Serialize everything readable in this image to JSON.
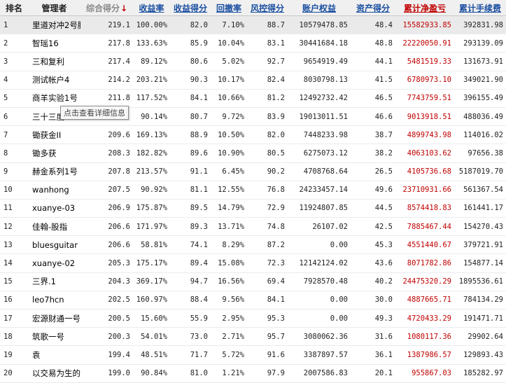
{
  "columns": {
    "rank": "排名",
    "manager": "管理者",
    "composite": "综合得分",
    "return_rate": "收益率",
    "return_score": "收益得分",
    "drawdown": "回撤率",
    "risk_score": "风控得分",
    "equity": "账户权益",
    "asset_score": "资产得分",
    "cum_pnl": "累计净盈亏",
    "cum_fee": "累计手续费"
  },
  "sort_arrow": "↓",
  "tooltip": "点击查看详细信息",
  "colors": {
    "header_bg": "#f0f0f0",
    "link_blue": "#1a4fa0",
    "red": "#c00000",
    "selected_row": "#eaeaea"
  },
  "rows": [
    {
      "rank": "1",
      "manager": "里道对冲2号腾",
      "composite": "219.1",
      "return_rate": "100.00%",
      "return_score": "82.0",
      "drawdown": "7.10%",
      "risk_score": "88.7",
      "equity": "10579478.85",
      "asset_score": "48.4",
      "cum_pnl": "15582933.85",
      "cum_fee": "392831.98"
    },
    {
      "rank": "2",
      "manager": "智瑶16",
      "composite": "217.8",
      "return_rate": "133.63%",
      "return_score": "85.9",
      "drawdown": "10.04%",
      "risk_score": "83.1",
      "equity": "30441684.18",
      "asset_score": "48.8",
      "cum_pnl": "22220050.91",
      "cum_fee": "293139.09"
    },
    {
      "rank": "3",
      "manager": "三和复利",
      "composite": "217.4",
      "return_rate": "89.12%",
      "return_score": "80.6",
      "drawdown": "5.02%",
      "risk_score": "92.7",
      "equity": "9654919.49",
      "asset_score": "44.1",
      "cum_pnl": "5481519.33",
      "cum_fee": "131673.91"
    },
    {
      "rank": "4",
      "manager": "测试帐户4",
      "composite": "214.2",
      "return_rate": "203.21%",
      "return_score": "90.3",
      "drawdown": "10.17%",
      "risk_score": "82.4",
      "equity": "8030798.13",
      "asset_score": "41.5",
      "cum_pnl": "6780973.10",
      "cum_fee": "349021.90"
    },
    {
      "rank": "5",
      "manager": "商羊实验1号",
      "composite": "211.8",
      "return_rate": "117.52%",
      "return_score": "84.1",
      "drawdown": "10.66%",
      "risk_score": "81.2",
      "equity": "12492732.42",
      "asset_score": "46.5",
      "cum_pnl": "7743759.51",
      "cum_fee": "396155.49"
    },
    {
      "rank": "6",
      "manager": "三十三度",
      "composite": "",
      "return_rate": "90.14%",
      "return_score": "80.7",
      "drawdown": "9.72%",
      "risk_score": "83.9",
      "equity": "19013011.51",
      "asset_score": "46.6",
      "cum_pnl": "9013918.51",
      "cum_fee": "488036.49"
    },
    {
      "rank": "7",
      "manager": "锄获金II",
      "composite": "209.6",
      "return_rate": "169.13%",
      "return_score": "88.9",
      "drawdown": "10.50%",
      "risk_score": "82.0",
      "equity": "7448233.98",
      "asset_score": "38.7",
      "cum_pnl": "4899743.98",
      "cum_fee": "114016.02"
    },
    {
      "rank": "8",
      "manager": "锄多获",
      "composite": "208.3",
      "return_rate": "182.82%",
      "return_score": "89.6",
      "drawdown": "10.90%",
      "risk_score": "80.5",
      "equity": "6275073.12",
      "asset_score": "38.2",
      "cum_pnl": "4063103.62",
      "cum_fee": "97656.38"
    },
    {
      "rank": "9",
      "manager": "赫金系列1号",
      "composite": "207.8",
      "return_rate": "213.57%",
      "return_score": "91.1",
      "drawdown": "6.45%",
      "risk_score": "90.2",
      "equity": "4708768.64",
      "asset_score": "26.5",
      "cum_pnl": "4105736.68",
      "cum_fee": "5187019.70"
    },
    {
      "rank": "10",
      "manager": "wanhong",
      "composite": "207.5",
      "return_rate": "90.92%",
      "return_score": "81.1",
      "drawdown": "12.55%",
      "risk_score": "76.8",
      "equity": "24233457.14",
      "asset_score": "49.6",
      "cum_pnl": "23710931.66",
      "cum_fee": "561367.54"
    },
    {
      "rank": "11",
      "manager": "xuanye-03",
      "composite": "206.9",
      "return_rate": "175.87%",
      "return_score": "89.5",
      "drawdown": "14.79%",
      "risk_score": "72.9",
      "equity": "11924807.85",
      "asset_score": "44.5",
      "cum_pnl": "8574418.83",
      "cum_fee": "161441.17"
    },
    {
      "rank": "12",
      "manager": "佳翰-股指",
      "composite": "206.6",
      "return_rate": "171.97%",
      "return_score": "89.3",
      "drawdown": "13.71%",
      "risk_score": "74.8",
      "equity": "26107.02",
      "asset_score": "42.5",
      "cum_pnl": "7885467.44",
      "cum_fee": "154270.43"
    },
    {
      "rank": "13",
      "manager": "bluesguitar",
      "composite": "206.6",
      "return_rate": "58.81%",
      "return_score": "74.1",
      "drawdown": "8.29%",
      "risk_score": "87.2",
      "equity": "0.00",
      "asset_score": "45.3",
      "cum_pnl": "4551440.67",
      "cum_fee": "379721.91"
    },
    {
      "rank": "14",
      "manager": "xuanye-02",
      "composite": "205.3",
      "return_rate": "175.17%",
      "return_score": "89.4",
      "drawdown": "15.08%",
      "risk_score": "72.3",
      "equity": "12142124.02",
      "asset_score": "43.6",
      "cum_pnl": "8071782.86",
      "cum_fee": "154877.14"
    },
    {
      "rank": "15",
      "manager": "三界.1",
      "composite": "204.3",
      "return_rate": "369.17%",
      "return_score": "94.7",
      "drawdown": "16.56%",
      "risk_score": "69.4",
      "equity": "7928570.48",
      "asset_score": "40.2",
      "cum_pnl": "24475320.29",
      "cum_fee": "1895536.61"
    },
    {
      "rank": "16",
      "manager": "leo7hcn",
      "composite": "202.5",
      "return_rate": "160.97%",
      "return_score": "88.4",
      "drawdown": "9.56%",
      "risk_score": "84.1",
      "equity": "0.00",
      "asset_score": "30.0",
      "cum_pnl": "4887665.71",
      "cum_fee": "784134.29"
    },
    {
      "rank": "17",
      "manager": "宏源财通一号",
      "composite": "200.5",
      "return_rate": "15.60%",
      "return_score": "55.9",
      "drawdown": "2.95%",
      "risk_score": "95.3",
      "equity": "0.00",
      "asset_score": "49.3",
      "cum_pnl": "4720433.29",
      "cum_fee": "191471.71"
    },
    {
      "rank": "18",
      "manager": "筑歌一号",
      "composite": "200.3",
      "return_rate": "54.01%",
      "return_score": "73.0",
      "drawdown": "2.71%",
      "risk_score": "95.7",
      "equity": "3080062.36",
      "asset_score": "31.6",
      "cum_pnl": "1080117.36",
      "cum_fee": "29902.64"
    },
    {
      "rank": "19",
      "manager": "袁",
      "composite": "199.4",
      "return_rate": "48.51%",
      "return_score": "71.7",
      "drawdown": "5.72%",
      "risk_score": "91.6",
      "equity": "3387897.57",
      "asset_score": "36.1",
      "cum_pnl": "1387986.57",
      "cum_fee": "129893.43"
    },
    {
      "rank": "20",
      "manager": "以交易为生的",
      "composite": "199.0",
      "return_rate": "90.84%",
      "return_score": "81.0",
      "drawdown": "1.21%",
      "risk_score": "97.9",
      "equity": "2007586.83",
      "asset_score": "20.1",
      "cum_pnl": "955867.03",
      "cum_fee": "185282.97"
    }
  ]
}
